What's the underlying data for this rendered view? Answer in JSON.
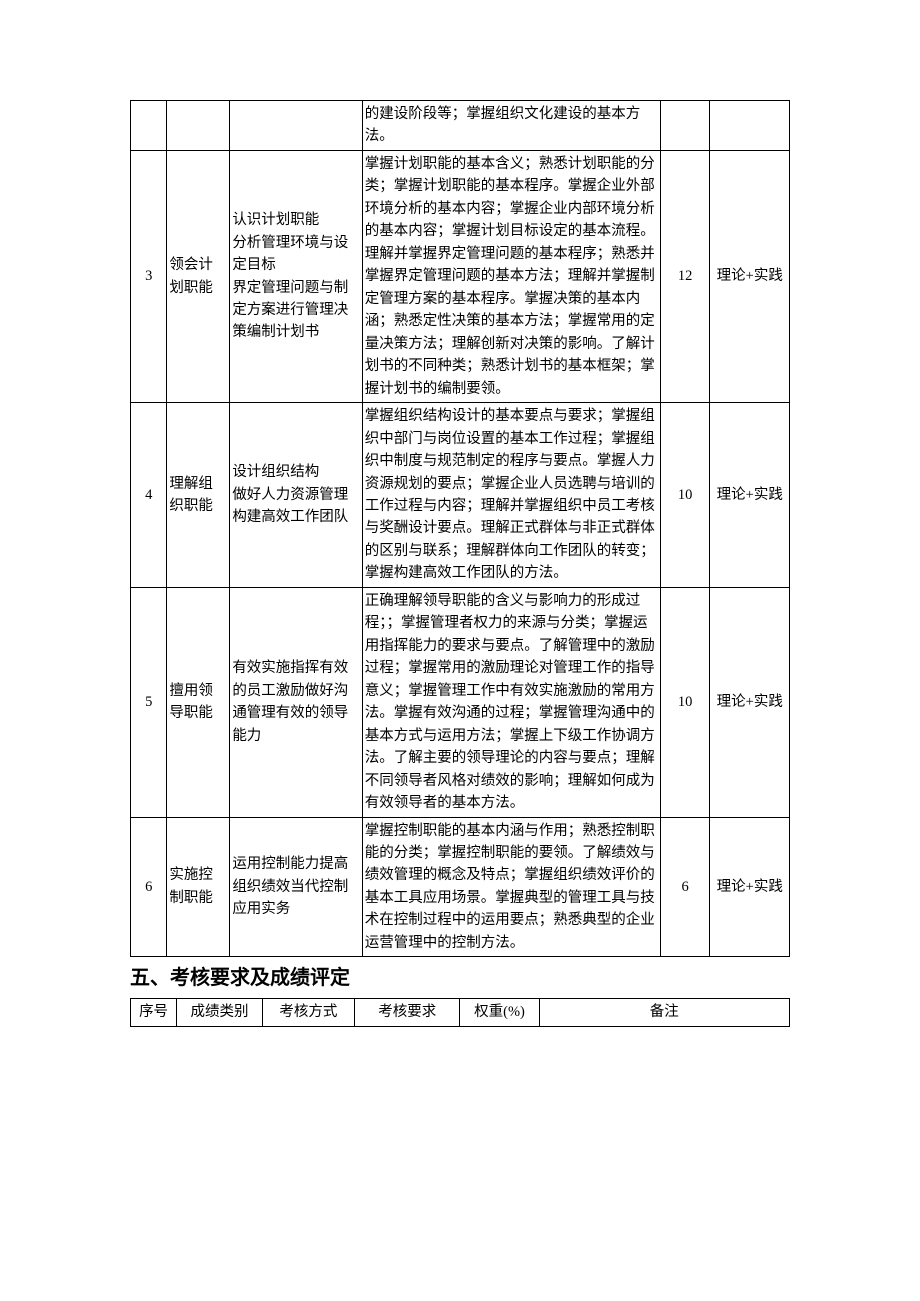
{
  "table1": {
    "rows": [
      {
        "num": "",
        "name": "",
        "items": "",
        "req": "的建设阶段等；掌握组织文化建设的基本方法。",
        "hours": "",
        "mode": ""
      },
      {
        "num": "3",
        "name": "领会计划职能",
        "items": "认识计划职能\n分析管理环境与设定目标\n界定管理问题与制定方案进行管理决策编制计划书",
        "req": "掌握计划职能的基本含义；熟悉计划职能的分类；掌握计划职能的基本程序。掌握企业外部环境分析的基本内容；掌握企业内部环境分析的基本内容；掌握计划目标设定的基本流程。理解并掌握界定管理问题的基本程序；熟悉并掌握界定管理问题的基本方法；理解并掌握制定管理方案的基本程序。掌握决策的基本内涵；熟悉定性决策的基本方法；掌握常用的定量决策方法；理解创新对决策的影响。了解计划书的不同种类；熟悉计划书的基本框架；掌握计划书的编制要领。",
        "hours": "12",
        "mode": "理论+实践"
      },
      {
        "num": "4",
        "name": "理解组织职能",
        "items": "设计组织结构\n做好人力资源管理\n构建高效工作团队",
        "req": "掌握组织结构设计的基本要点与要求；掌握组织中部门与岗位设置的基本工作过程；掌握组织中制度与规范制定的程序与要点。掌握人力资源规划的要点；掌握企业人员选聘与培训的工作过程与内容；理解并掌握组织中员工考核与奖酬设计要点。理解正式群体与非正式群体的区别与联系；理解群体向工作团队的转变；掌握构建高效工作团队的方法。",
        "hours": "10",
        "mode": "理论+实践"
      },
      {
        "num": "5",
        "name": "擅用领导职能",
        "items": "有效实施指挥有效的员工激励做好沟通管理有效的领导能力",
        "req": "正确理解领导职能的含义与影响力的形成过程；；掌握管理者权力的来源与分类；掌握运用指挥能力的要求与要点。了解管理中的激励过程；掌握常用的激励理论对管理工作的指导意义；掌握管理工作中有效实施激励的常用方法。掌握有效沟通的过程；掌握管理沟通中的基本方式与运用方法；掌握上下级工作协调方法。了解主要的领导理论的内容与要点；理解不同领导者风格对绩效的影响；理解如何成为有效领导者的基本方法。",
        "hours": "10",
        "mode": "理论+实践"
      },
      {
        "num": "6",
        "name": "实施控制职能",
        "items": "运用控制能力提高组织绩效当代控制应用实务",
        "req": "掌握控制职能的基本内涵与作用；熟悉控制职能的分类；掌握控制职能的要领。了解绩效与绩效管理的概念及特点；掌握组织绩效评价的基本工具应用场景。掌握典型的管理工具与技术在控制过程中的运用要点；熟悉典型的企业运营管理中的控制方法。",
        "hours": "6",
        "mode": "理论+实践"
      }
    ]
  },
  "section_heading": "五、考核要求及成绩评定",
  "table2": {
    "headers": {
      "c1": "序号",
      "c2": "成绩类别",
      "c3": "考核方式",
      "c4": "考核要求",
      "c5": "权重(%)",
      "c6": "备注"
    }
  }
}
